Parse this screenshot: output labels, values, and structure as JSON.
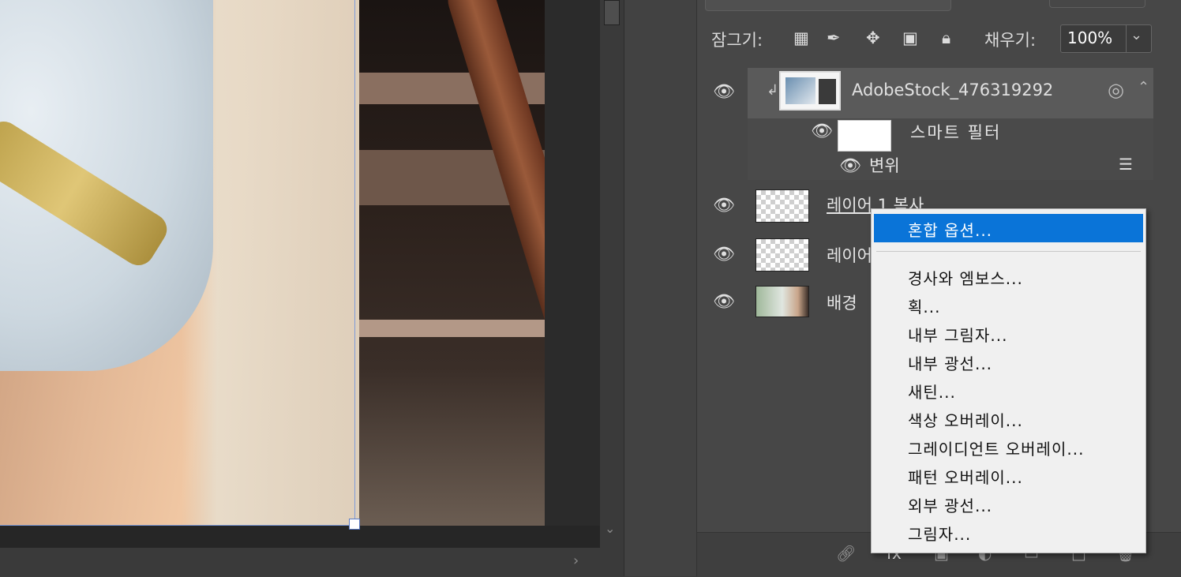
{
  "lock_bar": {
    "lock_label": "잠그기:",
    "fill_label": "채우기:",
    "fill_value": "100%",
    "lock_icons": [
      "checkerboard-icon",
      "brush-icon",
      "move-icon",
      "crop-icon",
      "lock-icon"
    ]
  },
  "layers": [
    {
      "name": "AdobeStock_476319292",
      "type": "smart-object"
    },
    {
      "name": "레이어 1 복사"
    },
    {
      "name": "레이어"
    },
    {
      "name": "배경"
    }
  ],
  "smart_filter": {
    "label": "스마트 필터",
    "filter_name": "변위"
  },
  "context_menu": {
    "selected": "혼합 옵션...",
    "items": [
      "경사와 엠보스...",
      "획...",
      "내부 그림자...",
      "내부 광선...",
      "새틴...",
      "색상 오버레이...",
      "그레이디언트 오버레이...",
      "패턴 오버레이...",
      "외부 광선...",
      "그림자..."
    ]
  },
  "colors": {
    "menu_highlight": "#0a74d8",
    "panel_bg": "#474747",
    "selection_frame": "#7d9ad8"
  }
}
